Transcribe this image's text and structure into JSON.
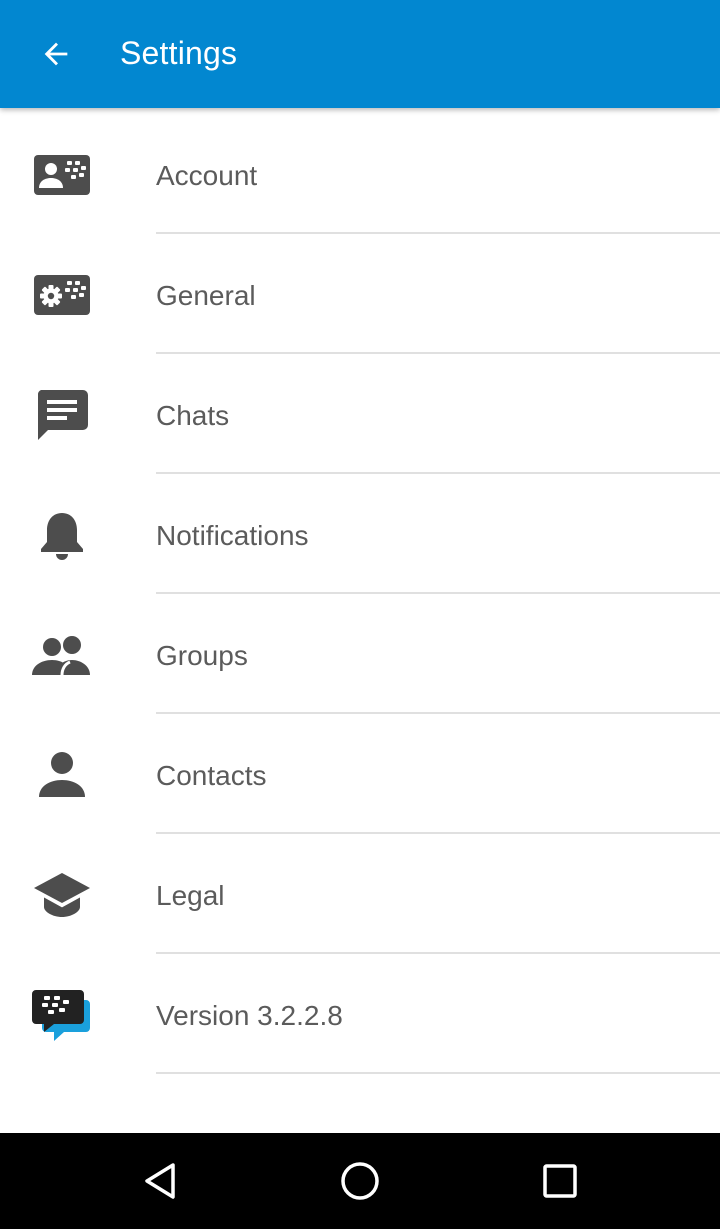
{
  "header": {
    "title": "Settings",
    "back_icon": "arrow-back-icon",
    "background": "#0287d0"
  },
  "settings": [
    {
      "label": "Account",
      "icon": "account-card-icon"
    },
    {
      "label": "General",
      "icon": "settings-gear-icon"
    },
    {
      "label": "Chats",
      "icon": "chat-bubble-icon"
    },
    {
      "label": "Notifications",
      "icon": "bell-icon"
    },
    {
      "label": "Groups",
      "icon": "groups-icon"
    },
    {
      "label": "Contacts",
      "icon": "person-icon"
    },
    {
      "label": "Legal",
      "icon": "graduation-cap-icon"
    },
    {
      "label": "Version 3.2.2.8",
      "icon": "bbm-logo-icon"
    }
  ],
  "navigation": {
    "back": "triangle-back-icon",
    "home": "circle-home-icon",
    "recents": "square-recents-icon"
  },
  "colors": {
    "icon_gray": "#4d4d4d",
    "label_gray": "#5b5b5b",
    "bbm_blue": "#1aa0dc"
  }
}
